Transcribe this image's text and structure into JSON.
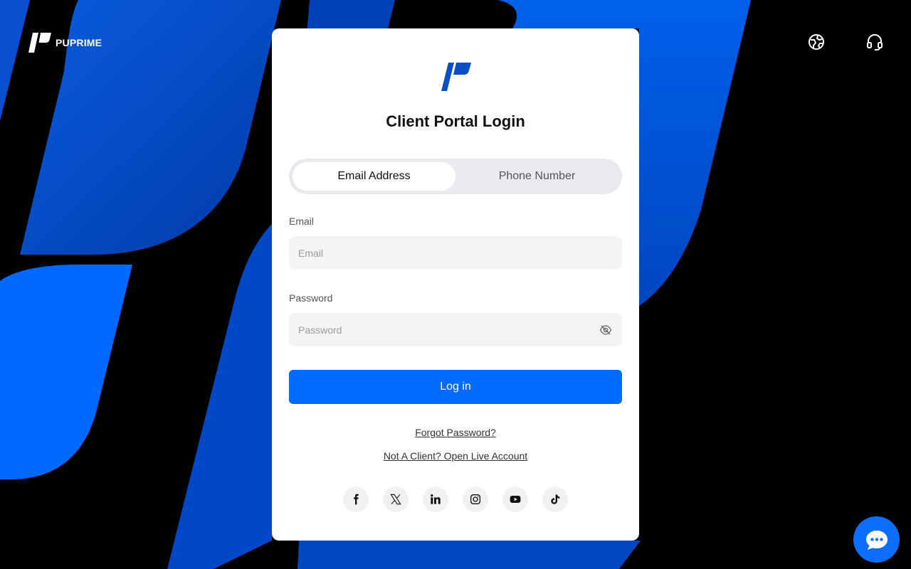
{
  "brand": {
    "name": "PUPRIME"
  },
  "header": {
    "icons": [
      "globe-icon",
      "headset-icon"
    ]
  },
  "login": {
    "title": "Client Portal Login",
    "tabs": [
      {
        "label": "Email Address",
        "active": true
      },
      {
        "label": "Phone Number",
        "active": false
      }
    ],
    "email": {
      "label": "Email",
      "placeholder": "Email",
      "value": ""
    },
    "password": {
      "label": "Password",
      "placeholder": "Password",
      "value": ""
    },
    "submit_label": "Log in",
    "forgot_label": "Forgot Password?",
    "signup_label": "Not A Client? Open Live Account",
    "socials": [
      "facebook-icon",
      "x-icon",
      "linkedin-icon",
      "instagram-icon",
      "youtube-icon",
      "tiktok-icon"
    ]
  },
  "chat": {
    "icon": "chat-icon"
  },
  "colors": {
    "primary": "#006cff",
    "brand_blue": "#0a4fc4",
    "background": "#000000",
    "card": "#ffffff"
  }
}
